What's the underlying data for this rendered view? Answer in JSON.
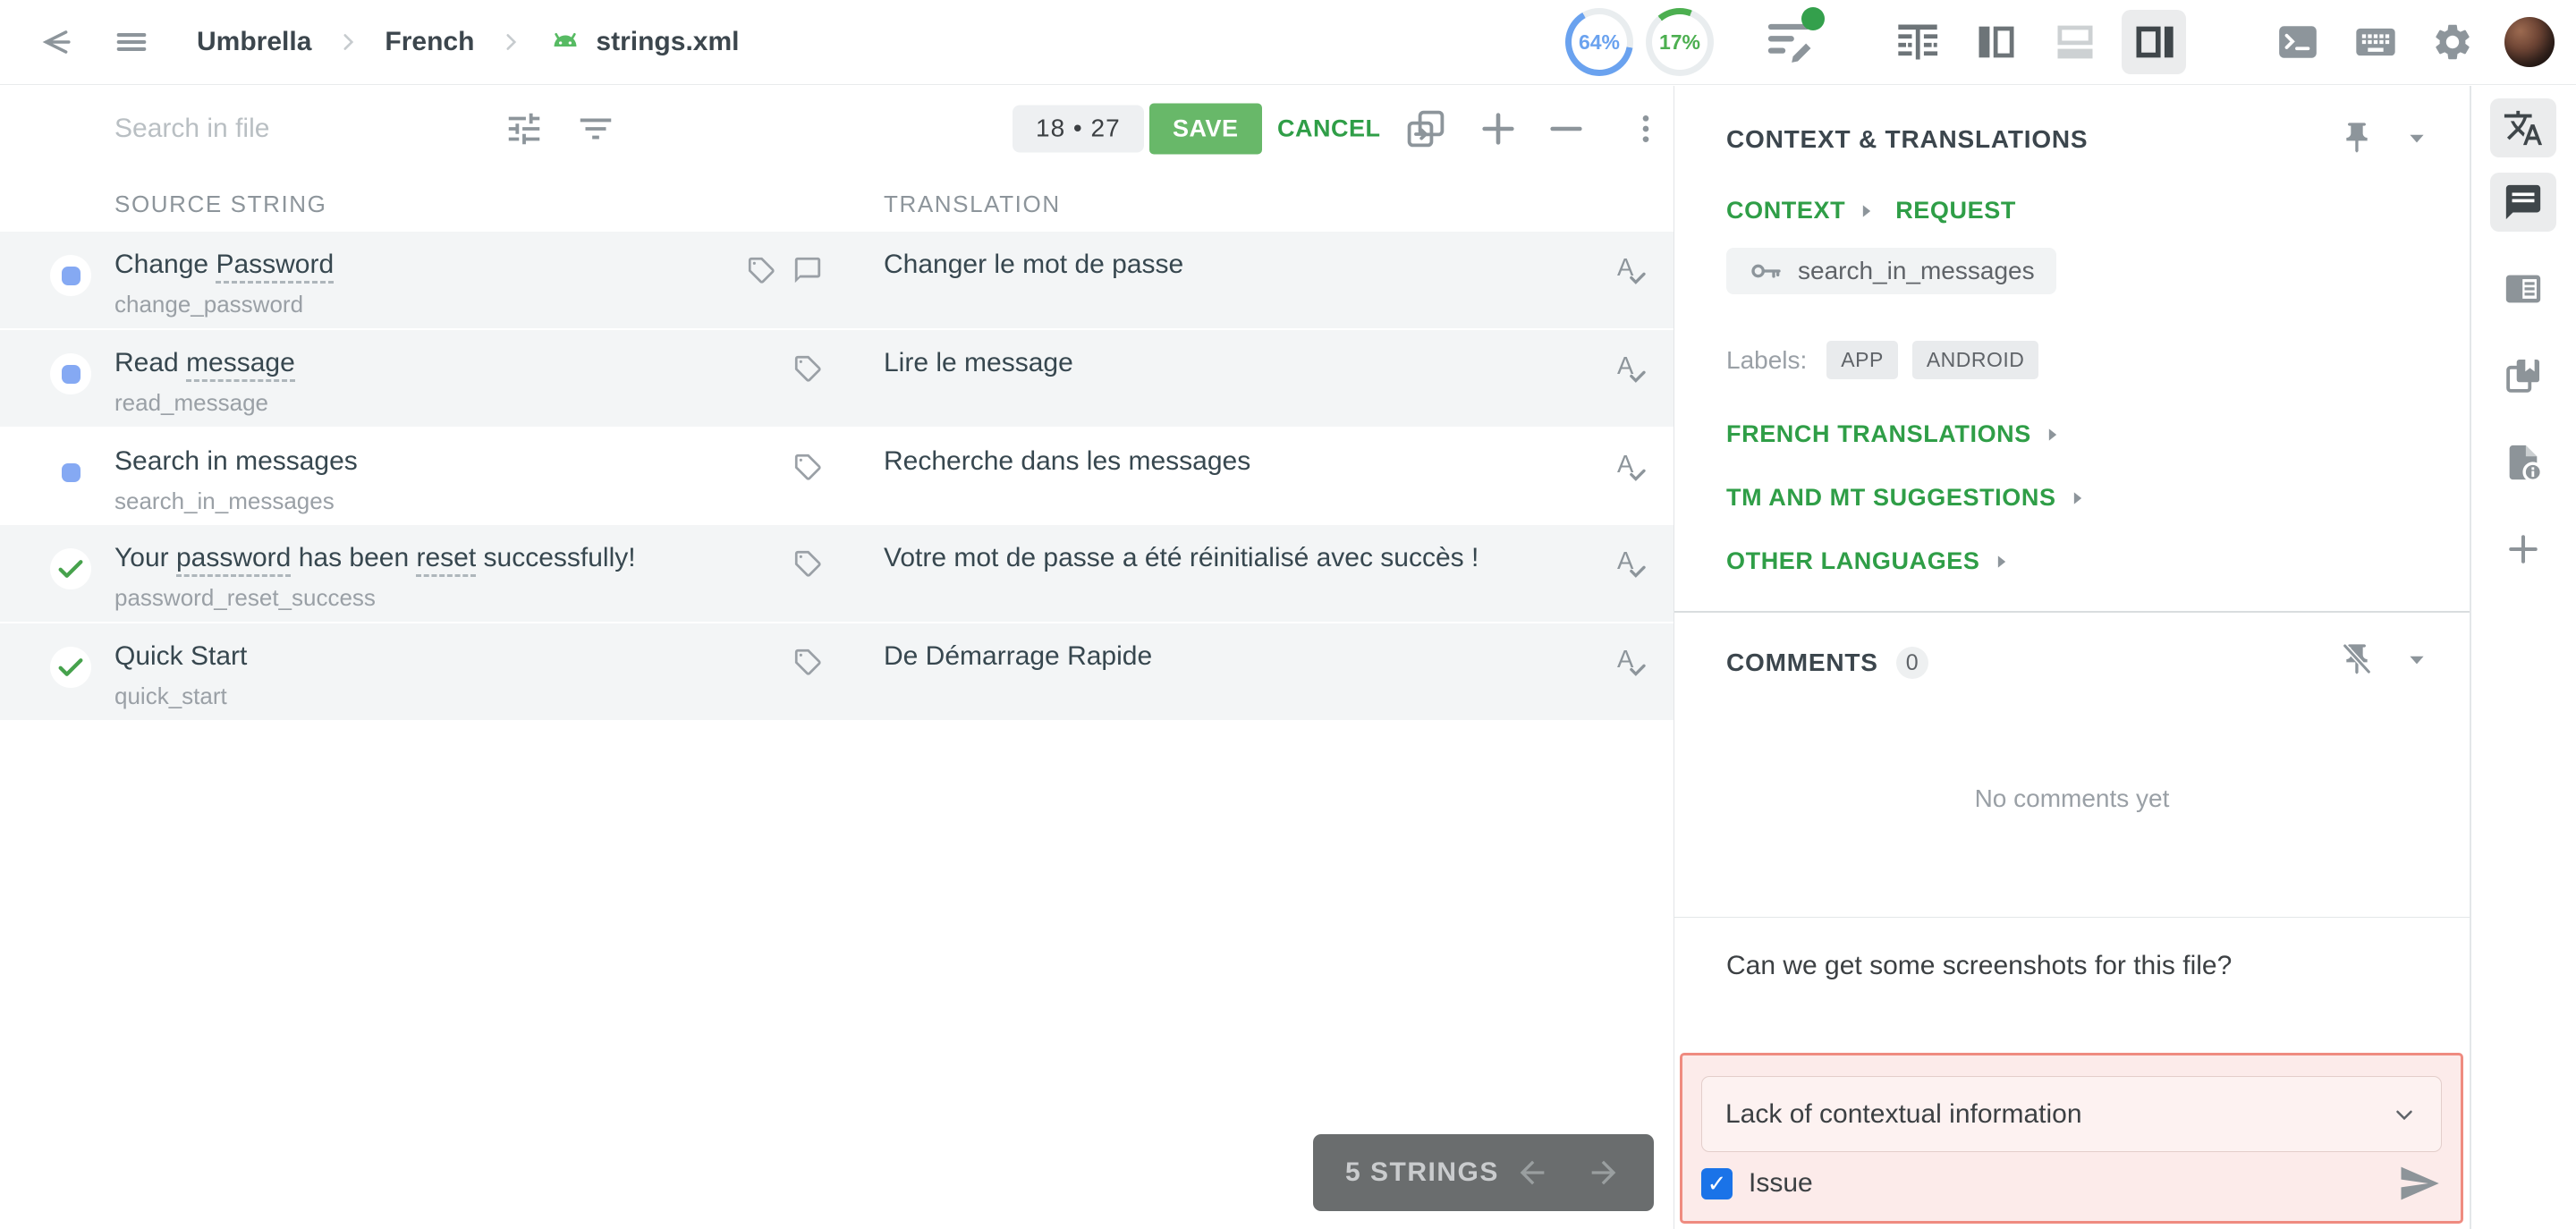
{
  "topbar": {
    "breadcrumb": {
      "project": "Umbrella",
      "language": "French",
      "file": "strings.xml"
    },
    "progress": [
      {
        "value": "64%",
        "percent": 64,
        "color": "#6aa2ef",
        "track": "#e9edef",
        "start": "100deg"
      },
      {
        "value": "17%",
        "percent": 17,
        "color": "#4caf50",
        "track": "#e9edef",
        "start": "-40deg"
      }
    ],
    "icons": [
      "back-arrow",
      "menu",
      "activity-edit",
      "editor-grid-view",
      "panel-left-view",
      "panel-bottom-view",
      "panel-right-view",
      "terminal",
      "keyboard",
      "gear",
      "avatar"
    ]
  },
  "toolbar": {
    "search_placeholder": "Search in file",
    "counter": "18 • 27",
    "save_label": "SAVE",
    "cancel_label": "CANCEL",
    "icons": [
      "tune",
      "filter",
      "copy-source",
      "plus",
      "minus",
      "more-vertical"
    ]
  },
  "table": {
    "headers": [
      "SOURCE STRING",
      "TRANSLATION"
    ],
    "rows": [
      {
        "status": "translated",
        "selected": false,
        "source": [
          {
            "t": "Change "
          },
          {
            "t": "Password",
            "u": true
          }
        ],
        "key": "change_password",
        "icons": [
          "tag",
          "comment-bubble"
        ],
        "translation": "Changer le mot de passe"
      },
      {
        "status": "translated",
        "selected": false,
        "source": [
          {
            "t": "Read "
          },
          {
            "t": "message",
            "u": true
          }
        ],
        "key": "read_message",
        "icons": [
          "tag"
        ],
        "translation": "Lire le message"
      },
      {
        "status": "translated",
        "selected": true,
        "source": [
          {
            "t": "Search in messages"
          }
        ],
        "key": "search_in_messages",
        "icons": [
          "tag"
        ],
        "translation": "Recherche dans les messages"
      },
      {
        "status": "approved",
        "selected": false,
        "source": [
          {
            "t": "Your "
          },
          {
            "t": "password",
            "u": true
          },
          {
            "t": " has been "
          },
          {
            "t": "reset",
            "u": true
          },
          {
            "t": " successfully!"
          }
        ],
        "key": "password_reset_success",
        "icons": [
          "tag"
        ],
        "translation": "Votre mot de passe a été réinitialisé avec succès !"
      },
      {
        "status": "approved",
        "selected": false,
        "source": [
          {
            "t": "Quick Start"
          }
        ],
        "key": "quick_start",
        "icons": [
          "tag"
        ],
        "translation": "De Démarrage Rapide"
      }
    ]
  },
  "pager": {
    "label": "5 STRINGS",
    "icons": [
      "arrow-left",
      "arrow-right"
    ]
  },
  "context_panel": {
    "title": "CONTEXT & TRANSLATIONS",
    "context_link": "CONTEXT",
    "request_link": "REQUEST",
    "string_key": "search_in_messages",
    "labels_caption": "Labels:",
    "labels": [
      "APP",
      "ANDROID"
    ],
    "sections": [
      "FRENCH TRANSLATIONS",
      "TM AND MT SUGGESTIONS",
      "OTHER LANGUAGES"
    ],
    "icons": [
      "pin",
      "chevron-down",
      "key"
    ]
  },
  "comments_panel": {
    "title": "COMMENTS",
    "count": "0",
    "empty_text": "No comments yet",
    "draft_text": "Can we get some screenshots for this file?",
    "issue_type_selected": "Lack of contextual information",
    "issue_checkbox_label": "Issue",
    "issue_checkbox_checked": true,
    "icons": [
      "pin-off",
      "chevron-down",
      "checkbox-checked",
      "send"
    ]
  },
  "rail": {
    "items": [
      {
        "name": "translate",
        "active": true
      },
      {
        "name": "comments",
        "active": true
      },
      {
        "name": "context-card",
        "active": false
      },
      {
        "name": "glossary-pages",
        "active": false
      },
      {
        "name": "file-info",
        "active": false
      },
      {
        "name": "add",
        "active": false
      }
    ]
  },
  "colors": {
    "accent_green": "#2f9e47",
    "save_button_bg": "#68b869",
    "translated_blue": "#85a9f3",
    "approved_green": "#46a24c",
    "checkbox_blue": "#1a73e8",
    "issue_box_bg": "#fcebea",
    "issue_box_border": "#ef8b80",
    "row_gray_bg": "#f3f5f6",
    "pager_bg": "#6a6d6e",
    "android_green": "#57bb63"
  }
}
